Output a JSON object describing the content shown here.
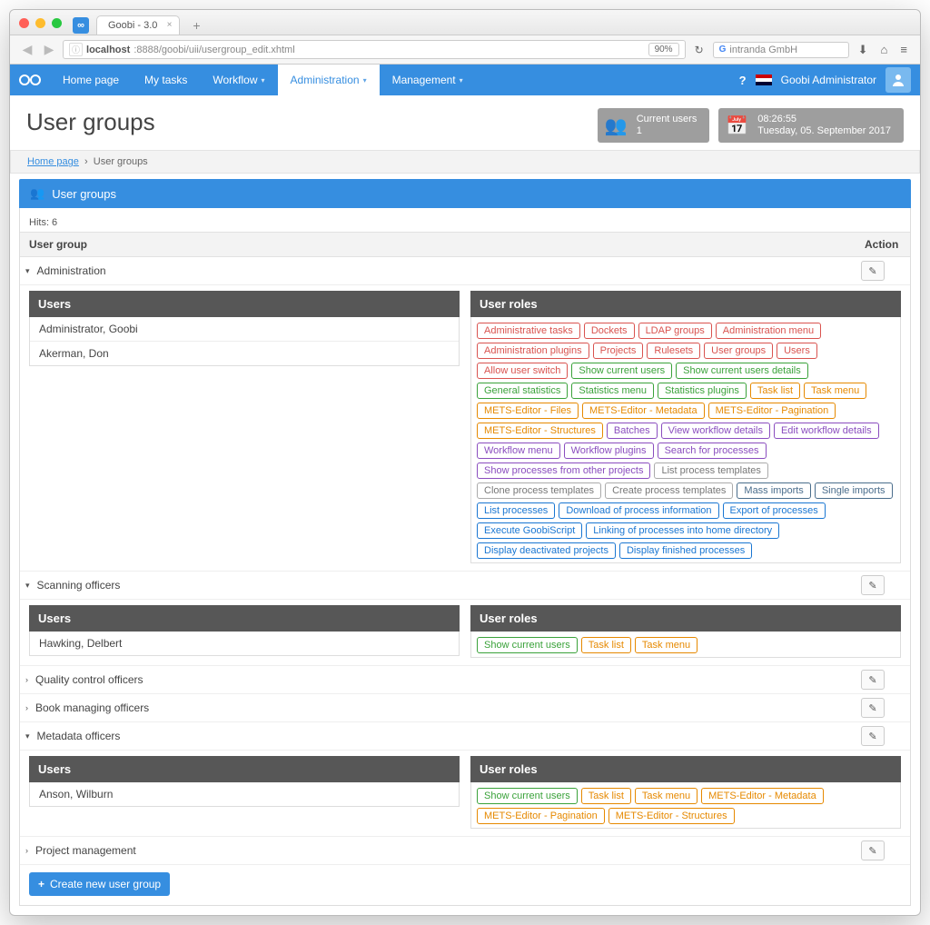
{
  "browser": {
    "tab_title": "Goobi - 3.0",
    "url_host": "localhost",
    "url_path": ":8888/goobi/uii/usergroup_edit.xhtml",
    "zoom": "90%",
    "search_placeholder": "intranda GmbH"
  },
  "nav": {
    "items": [
      "Home page",
      "My tasks",
      "Workflow",
      "Administration",
      "Management"
    ],
    "admin": "Goobi Administrator"
  },
  "header": {
    "title": "User groups",
    "card_users_label": "Current users",
    "card_users_count": "1",
    "card_time": "08:26:55",
    "card_date": "Tuesday, 05. September 2017"
  },
  "breadcrumb": {
    "home": "Home page",
    "current": "User groups"
  },
  "panel": {
    "title": "User groups",
    "hits": "Hits: 6",
    "col_group": "User group",
    "col_action": "Action",
    "create_label": "Create new user group"
  },
  "sections": {
    "users_hd": "Users",
    "roles_hd": "User roles"
  },
  "groups": [
    {
      "name": "Administration",
      "expanded": true,
      "users": [
        "Administrator, Goobi",
        "Akerman, Don"
      ],
      "roles": [
        {
          "t": "Administrative tasks",
          "c": "red"
        },
        {
          "t": "Dockets",
          "c": "red"
        },
        {
          "t": "LDAP groups",
          "c": "red"
        },
        {
          "t": "Administration menu",
          "c": "red"
        },
        {
          "t": "Administration plugins",
          "c": "red"
        },
        {
          "t": "Projects",
          "c": "red"
        },
        {
          "t": "Rulesets",
          "c": "red"
        },
        {
          "t": "User groups",
          "c": "red"
        },
        {
          "t": "Users",
          "c": "red"
        },
        {
          "t": "Allow user switch",
          "c": "red"
        },
        {
          "t": "Show current users",
          "c": "green"
        },
        {
          "t": "Show current users details",
          "c": "green"
        },
        {
          "t": "General statistics",
          "c": "green"
        },
        {
          "t": "Statistics menu",
          "c": "green"
        },
        {
          "t": "Statistics plugins",
          "c": "green"
        },
        {
          "t": "Task list",
          "c": "orange"
        },
        {
          "t": "Task menu",
          "c": "orange"
        },
        {
          "t": "METS-Editor - Files",
          "c": "orange"
        },
        {
          "t": "METS-Editor - Metadata",
          "c": "orange"
        },
        {
          "t": "METS-Editor - Pagination",
          "c": "orange"
        },
        {
          "t": "METS-Editor - Structures",
          "c": "orange"
        },
        {
          "t": "Batches",
          "c": "purple"
        },
        {
          "t": "View workflow details",
          "c": "purple"
        },
        {
          "t": "Edit workflow details",
          "c": "purple"
        },
        {
          "t": "Workflow menu",
          "c": "purple"
        },
        {
          "t": "Workflow plugins",
          "c": "purple"
        },
        {
          "t": "Search for processes",
          "c": "purple"
        },
        {
          "t": "Show processes from other projects",
          "c": "purple"
        },
        {
          "t": "List process templates",
          "c": "gray"
        },
        {
          "t": "Clone process templates",
          "c": "gray"
        },
        {
          "t": "Create process templates",
          "c": "gray"
        },
        {
          "t": "Mass imports",
          "c": "steel"
        },
        {
          "t": "Single imports",
          "c": "steel"
        },
        {
          "t": "List processes",
          "c": "blue"
        },
        {
          "t": "Download of process information",
          "c": "blue"
        },
        {
          "t": "Export of processes",
          "c": "blue"
        },
        {
          "t": "Execute GoobiScript",
          "c": "blue"
        },
        {
          "t": "Linking of processes into home directory",
          "c": "blue"
        },
        {
          "t": "Display deactivated projects",
          "c": "blue"
        },
        {
          "t": "Display finished processes",
          "c": "blue"
        }
      ]
    },
    {
      "name": "Scanning officers",
      "expanded": true,
      "users": [
        "Hawking, Delbert"
      ],
      "roles": [
        {
          "t": "Show current users",
          "c": "green"
        },
        {
          "t": "Task list",
          "c": "orange"
        },
        {
          "t": "Task menu",
          "c": "orange"
        }
      ]
    },
    {
      "name": "Quality control officers",
      "expanded": false
    },
    {
      "name": "Book managing officers",
      "expanded": false
    },
    {
      "name": "Metadata officers",
      "expanded": true,
      "users": [
        "Anson, Wilburn"
      ],
      "roles": [
        {
          "t": "Show current users",
          "c": "green"
        },
        {
          "t": "Task list",
          "c": "orange"
        },
        {
          "t": "Task menu",
          "c": "orange"
        },
        {
          "t": "METS-Editor - Metadata",
          "c": "orange"
        },
        {
          "t": "METS-Editor - Pagination",
          "c": "orange"
        },
        {
          "t": "METS-Editor - Structures",
          "c": "orange"
        }
      ]
    },
    {
      "name": "Project management",
      "expanded": false
    }
  ]
}
